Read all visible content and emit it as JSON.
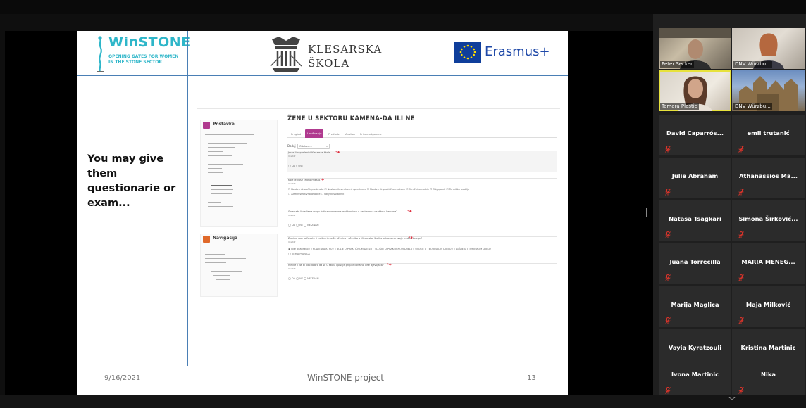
{
  "slide": {
    "logo_winstone_title": "WinSTONE",
    "logo_winstone_sub1": "OPENING GATES FOR WOMEN",
    "logo_winstone_sub2": "IN THE STONE SECTOR",
    "logo_klesarska_line1": "KLESARSKA",
    "logo_klesarska_line2": "ŠKOLA",
    "logo_erasmus": "Erasmus+",
    "text_line1": "You may give",
    "text_line2": "them",
    "text_line3": "questionarie or",
    "text_line4": "exam...",
    "footer_date": "9/16/2021",
    "footer_title": "WinSTONE project",
    "footer_page": "13"
  },
  "moodle": {
    "nav_title": "Postavke",
    "nav2_title": "Navigacija",
    "form_title": "ŽENE U SEKTORU KAMENA-DA ILI NE",
    "tabs": [
      "Pregled",
      "Uređivanje",
      "Predlošci",
      "Analiza",
      "Prikaz odgovora"
    ],
    "select_label": "Dodaj",
    "select_value": "Odaberi...",
    "q1_text": "Jeste li zaposlenici Klesarske škole",
    "q1_sub": "Uredi ▾",
    "q1_opts": "◯ DA ◯ NE",
    "q2_text": "Koje je Vaše radno mjesto?",
    "q2_sub": "Uredi ▾",
    "q2_opts1": "☐ Nastavnik općih predmeta ☐ Nastavnik strukovnih predmeta ☐ Nastavnik praktične nastave ☐ Stručni suradnik ☐ Odgajatelj ☐ Tehničko osoblje",
    "q2_opts2": "☐ Administrativno osoblje ☐ Vanjski suradnik",
    "q3_text": "Smatrate li da žene mogu biti ravnopravne muškarcima u zanimanju u sektoru kamena?",
    "q3_sub": "Uredi ▾",
    "q3_opts": "◯ DA ◯ NE ◯ NE ZNAM",
    "q4_text": "Zanima nas uočavate li razliku između učenica i učenika u Klesarskoj školi u odnosu na svoje muške kolege?",
    "q4_sub": "Uredi ▾",
    "q4_opts1": "◉ Nije odabrano ◯ PODJEDNAKI SU ◯ BOLJE U PRAKTIČNOM DIJELU ◯ LOŠIJE U PRAKTIČNOM DIJELU ◯ BOLJE U TEORIJSKOM DIJELU ◯ LOŠIJE U TEORIJSKOM DIJELU",
    "q4_opts2": "◯ NEMA PRAVILA",
    "q5_text": "Mislite li da bi bilo dobro da se u školu upisuje proporcionalno više djevojaka?",
    "q5_sub": "Uredi ▾",
    "q5_opts": "◯ DA ◯ NE ◯ NE ZNAM"
  },
  "participants": {
    "video": [
      {
        "name": "Peter Secker"
      },
      {
        "name": "DNV Würzbu..."
      },
      {
        "name": "Tamara Plastic"
      },
      {
        "name": "DNV Würzbu..."
      }
    ],
    "tiles": [
      {
        "name": "David Caparrós..."
      },
      {
        "name": "emil trutanić"
      },
      {
        "name": "Julie Abraham"
      },
      {
        "name": "Athanassios Ma..."
      },
      {
        "name": "Natasa Tsagkari"
      },
      {
        "name": "Simona Širković..."
      },
      {
        "name": "Juana Torrecilla"
      },
      {
        "name": "MARIA MENEG..."
      },
      {
        "name": "Marija Maglica"
      },
      {
        "name": "Maja Milković"
      },
      {
        "name": "Vayia Kyratzouli"
      },
      {
        "name": "Kristina Martinic"
      },
      {
        "name": "Ivona Martinic"
      },
      {
        "name": "Nika"
      }
    ]
  },
  "colors": {
    "accent_moodle": "#b03a8f",
    "winstone_teal": "#2eb6c9",
    "erasmus_blue": "#1f49a8",
    "active_speaker": "#e7e23c",
    "muted_red": "#d9342b"
  }
}
